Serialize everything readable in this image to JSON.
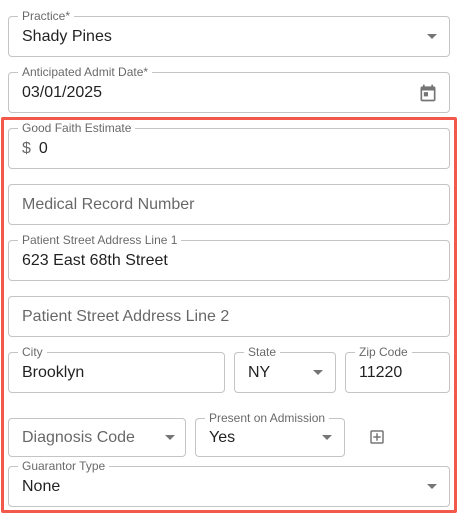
{
  "practice": {
    "label": "Practice*",
    "value": "Shady Pines"
  },
  "admit_date": {
    "label": "Anticipated Admit Date*",
    "value": "03/01/2025"
  },
  "good_faith": {
    "label": "Good Faith Estimate",
    "prefix": "$",
    "value": "0"
  },
  "mrn": {
    "placeholder": "Medical Record Number"
  },
  "address1": {
    "label": "Patient Street Address Line 1",
    "value": "623 East 68th Street"
  },
  "address2": {
    "placeholder": "Patient Street Address Line 2"
  },
  "city": {
    "label": "City",
    "value": "Brooklyn"
  },
  "state": {
    "label": "State",
    "value": "NY"
  },
  "zip": {
    "label": "Zip Code",
    "value": "11220"
  },
  "diagnosis": {
    "placeholder": "Diagnosis Code"
  },
  "present_on_admission": {
    "label": "Present on Admission",
    "value": "Yes"
  },
  "guarantor": {
    "label": "Guarantor Type",
    "value": "None"
  },
  "colors": {
    "highlight": "#f2594b",
    "border": "#c4c4c4",
    "text": "#212121",
    "label": "#666666"
  },
  "icons": {
    "calendar": "calendar-icon",
    "dropdown": "chevron-down-icon",
    "add": "add-box-icon"
  }
}
